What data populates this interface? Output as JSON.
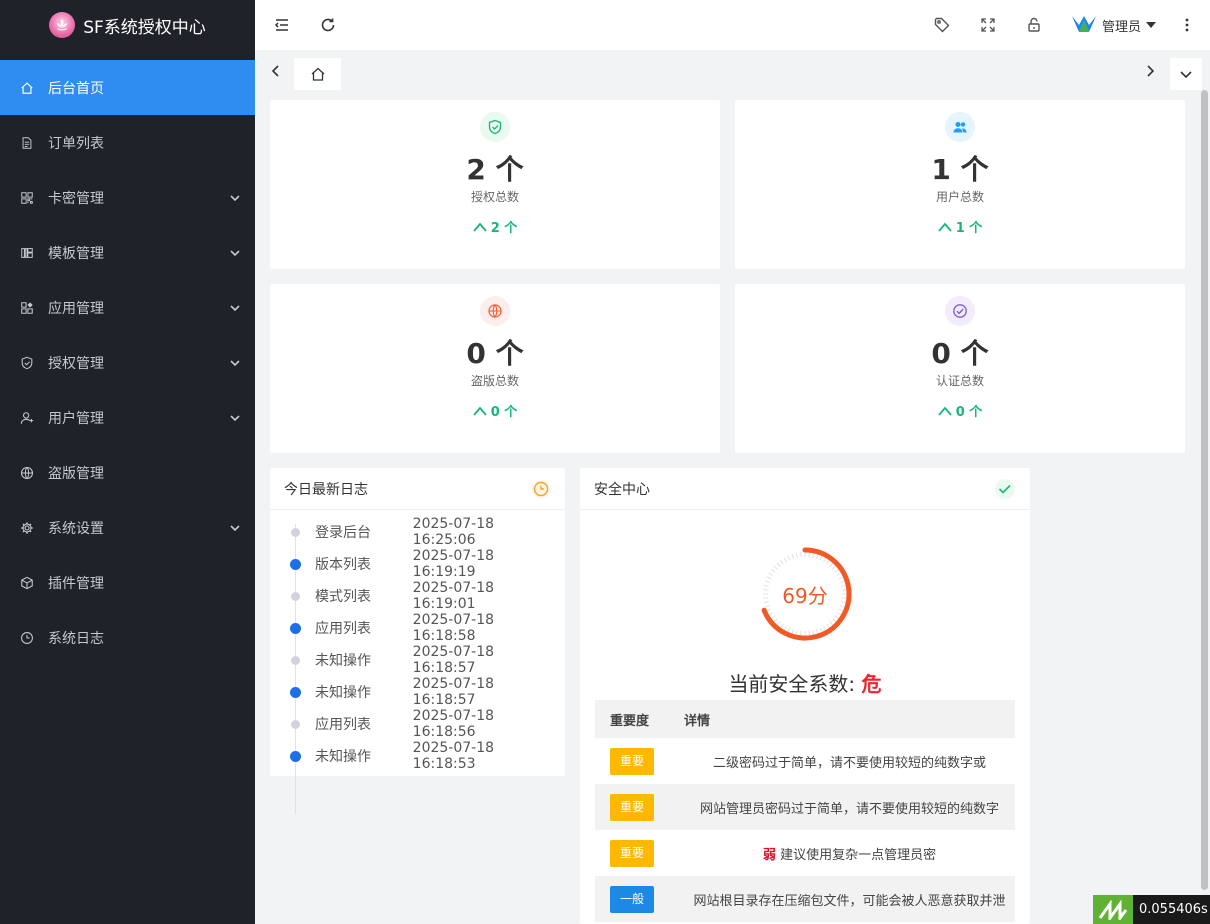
{
  "brand": {
    "title": "SF系统授权中心"
  },
  "sidebar": {
    "items": [
      {
        "label": "后台首页",
        "icon": "home-icon",
        "active": true,
        "has_children": false
      },
      {
        "label": "订单列表",
        "icon": "document-icon",
        "has_children": false
      },
      {
        "label": "卡密管理",
        "icon": "qrcode-icon",
        "has_children": true
      },
      {
        "label": "模板管理",
        "icon": "template-icon",
        "has_children": true
      },
      {
        "label": "应用管理",
        "icon": "apps-icon",
        "has_children": true
      },
      {
        "label": "授权管理",
        "icon": "shield-icon",
        "has_children": true
      },
      {
        "label": "用户管理",
        "icon": "user-icon",
        "has_children": true
      },
      {
        "label": "盗版管理",
        "icon": "globe-icon",
        "has_children": false
      },
      {
        "label": "系统设置",
        "icon": "gear-icon",
        "has_children": true
      },
      {
        "label": "插件管理",
        "icon": "box-icon",
        "has_children": false
      },
      {
        "label": "系统日志",
        "icon": "clock-icon",
        "has_children": false
      }
    ]
  },
  "header": {
    "user_name": "管理员"
  },
  "stats": [
    {
      "value": "2 个",
      "label": "授权总数",
      "delta": "2 个",
      "icon": "shield-check-icon",
      "color": "#16b777",
      "bg": "#eafaf1"
    },
    {
      "value": "1 个",
      "label": "用户总数",
      "delta": "1 个",
      "icon": "users-icon",
      "color": "#1e9fff",
      "bg": "#e6f4ff"
    },
    {
      "value": "0 个",
      "label": "盗版总数",
      "delta": "0 个",
      "icon": "globe-icon",
      "color": "#ff5722",
      "bg": "#fdeeee"
    },
    {
      "value": "0 个",
      "label": "认证总数",
      "delta": "0 个",
      "icon": "check-circle-icon",
      "color": "#7b5bd6",
      "bg": "#f3ecfd"
    }
  ],
  "logs": {
    "title": "今日最新日志",
    "items": [
      {
        "name": "登录后台",
        "time": "2025-07-18 16:25:06",
        "blue": false
      },
      {
        "name": "版本列表",
        "time": "2025-07-18 16:19:19",
        "blue": true
      },
      {
        "name": "模式列表",
        "time": "2025-07-18 16:19:01",
        "blue": false
      },
      {
        "name": "应用列表",
        "time": "2025-07-18 16:18:58",
        "blue": true
      },
      {
        "name": "未知操作",
        "time": "2025-07-18 16:18:57",
        "blue": false
      },
      {
        "name": "未知操作",
        "time": "2025-07-18 16:18:57",
        "blue": true
      },
      {
        "name": "应用列表",
        "time": "2025-07-18 16:18:56",
        "blue": false
      },
      {
        "name": "未知操作",
        "time": "2025-07-18 16:18:53",
        "blue": true
      }
    ]
  },
  "security": {
    "title": "安全中心",
    "score": 69,
    "score_text": "69分",
    "level_label": "当前安全系数:",
    "level": "危",
    "table": {
      "headers": [
        "重要度",
        "详情"
      ],
      "rows": [
        {
          "level": "重要",
          "type": "warn",
          "weak_tag": "",
          "detail": "二级密码过于简单，请不要使用较短的纯数字或"
        },
        {
          "level": "重要",
          "type": "warn",
          "weak_tag": "",
          "detail": "网站管理员密码过于简单，请不要使用较短的纯数字"
        },
        {
          "level": "重要",
          "type": "warn",
          "weak_tag": "弱",
          "detail": "建议使用复杂一点管理员密"
        },
        {
          "level": "一般",
          "type": "info",
          "weak_tag": "",
          "detail": "网站根目录存在压缩包文件，可能会被人恶意获取并泄"
        }
      ]
    }
  },
  "timer": {
    "value": "0.055406s"
  }
}
